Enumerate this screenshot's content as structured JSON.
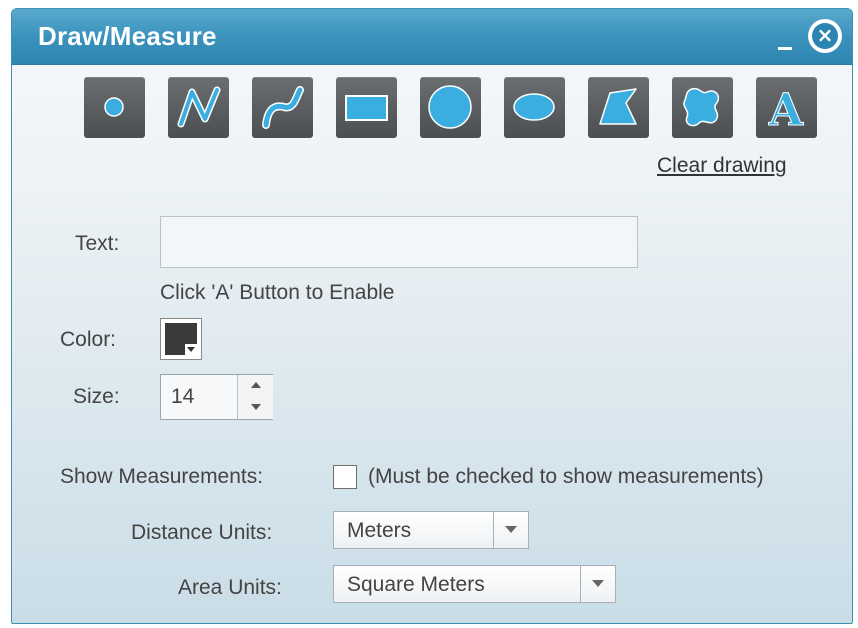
{
  "window": {
    "title": "Draw/Measure",
    "close_glyph": "×"
  },
  "toolbar": {
    "tools": [
      {
        "name": "point",
        "icon": "point-icon"
      },
      {
        "name": "polyline",
        "icon": "polyline-icon"
      },
      {
        "name": "freehand-polyline",
        "icon": "freehand-polyline-icon"
      },
      {
        "name": "rectangle",
        "icon": "rectangle-icon"
      },
      {
        "name": "circle",
        "icon": "circle-icon"
      },
      {
        "name": "ellipse",
        "icon": "ellipse-icon"
      },
      {
        "name": "polygon",
        "icon": "polygon-icon"
      },
      {
        "name": "freehand-polygon",
        "icon": "freehand-polygon-icon"
      },
      {
        "name": "text",
        "icon": "text-icon",
        "glyph": "A"
      }
    ],
    "clear_label": "Clear drawing"
  },
  "form": {
    "text_label": "Text:",
    "text_value": "",
    "text_hint": "Click 'A' Button to Enable",
    "color_label": "Color:",
    "color_value": "#3a3a3a",
    "size_label": "Size:",
    "size_value": "14",
    "show_measurements_label": "Show Measurements:",
    "show_measurements_checked": false,
    "show_measurements_note": "(Must be checked to show measurements)",
    "distance_units_label": "Distance Units:",
    "distance_units_value": "Meters",
    "area_units_label": "Area Units:",
    "area_units_value": "Square Meters"
  },
  "colors": {
    "titlebar": "#3b93bd",
    "tool_button": "#55585b",
    "tool_icon": "#3aaee0"
  }
}
